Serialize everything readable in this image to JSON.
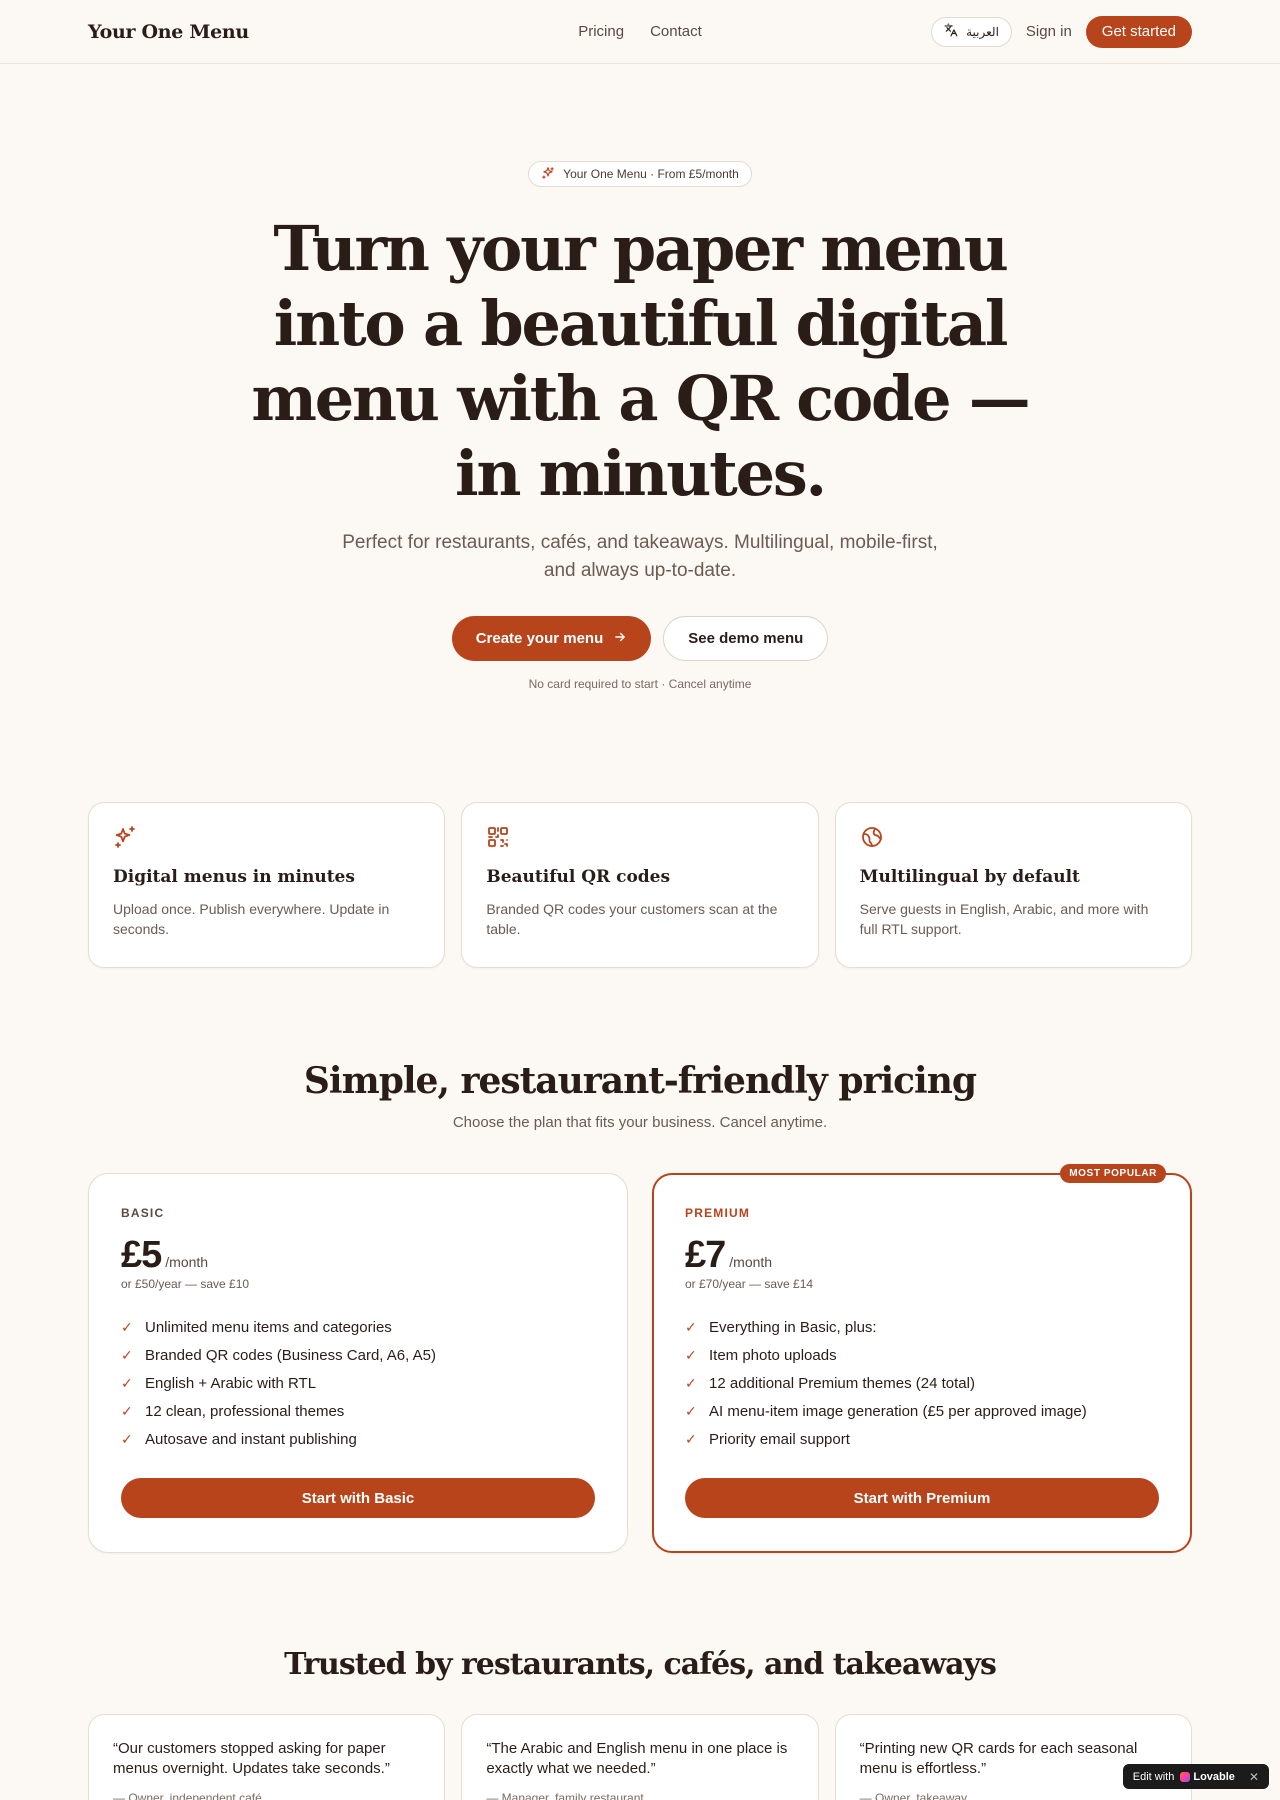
{
  "header": {
    "brand": "Your One Menu",
    "nav": [
      "Pricing",
      "Contact"
    ],
    "language_label": "العربية",
    "signin_label": "Sign in",
    "get_started_label": "Get started"
  },
  "hero": {
    "pill": "Your One Menu · From £5/month",
    "title": "Turn your paper menu into a beautiful digital menu with a QR code — in minutes.",
    "subtitle": "Perfect for restaurants, cafés, and takeaways. Multilingual, mobile-first, and always up-to-date.",
    "primary_cta": "Create your menu",
    "secondary_cta": "See demo menu",
    "note": "No card required to start · Cancel anytime"
  },
  "features": [
    {
      "icon": "sparkles-icon",
      "title": "Digital menus in minutes",
      "text": "Upload once. Publish everywhere. Update in seconds."
    },
    {
      "icon": "qr-code-icon",
      "title": "Beautiful QR codes",
      "text": "Branded QR codes your customers scan at the table."
    },
    {
      "icon": "globe-icon",
      "title": "Multilingual by default",
      "text": "Serve guests in English, Arabic, and more with full RTL support."
    }
  ],
  "pricing": {
    "title": "Simple, restaurant-friendly pricing",
    "subtitle": "Choose the plan that fits your business. Cancel anytime.",
    "plans": [
      {
        "name": "BASIC",
        "price": "£5",
        "period": "/month",
        "yearly": "or £50/year — save £10",
        "features": [
          "Unlimited menu items and categories",
          "Branded QR codes (Business Card, A6, A5)",
          "English + Arabic with RTL",
          "12 clean, professional themes",
          "Autosave and instant publishing"
        ],
        "button": "Start with Basic"
      },
      {
        "name": "PREMIUM",
        "badge": "MOST POPULAR",
        "price": "£7",
        "period": "/month",
        "yearly": "or £70/year — save £14",
        "features": [
          "Everything in Basic, plus:",
          "Item photo uploads",
          "12 additional Premium themes (24 total)",
          "AI menu-item image generation (£5 per approved image)",
          "Priority email support"
        ],
        "button": "Start with Premium"
      }
    ]
  },
  "testimonials": {
    "title": "Trusted by restaurants, cafés, and takeaways",
    "items": [
      {
        "quote": "“Our customers stopped asking for paper menus overnight. Updates take seconds.”",
        "author": "— Owner, independent café"
      },
      {
        "quote": "“The Arabic and English menu in one place is exactly what we needed.”",
        "author": "— Manager, family restaurant"
      },
      {
        "quote": "“Printing new QR cards for each seasonal menu is effortless.”",
        "author": "— Owner, takeaway"
      }
    ]
  },
  "lovable_badge": {
    "prefix": "Edit with",
    "brand": "Lovable"
  },
  "colors": {
    "accent": "#b8441b",
    "background": "#fcf8f3"
  }
}
